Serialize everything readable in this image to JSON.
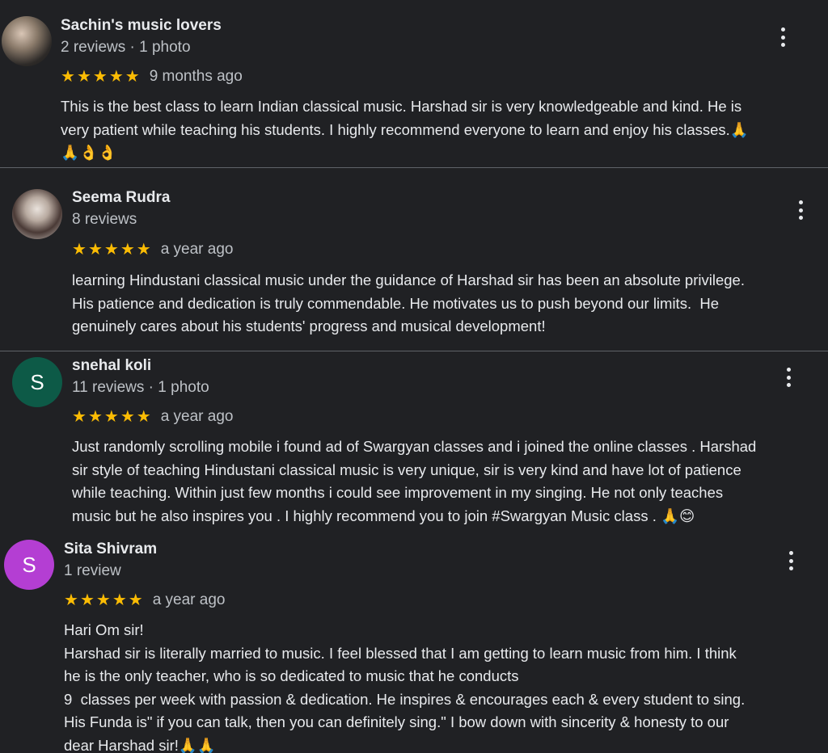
{
  "reviews": [
    {
      "name": "Sachin's music lovers",
      "meta": "2 reviews · 1 photo",
      "rating": 5,
      "time": "9 months ago",
      "text": "This is the best class to learn Indian classical music. Harshad sir is very knowledgeable and kind. He is\nvery patient while teaching his students. I highly recommend everyone to learn and enjoy his classes.🙏\n🙏👌👌",
      "avatar": "photo"
    },
    {
      "name": "Seema Rudra",
      "meta": "8 reviews",
      "rating": 5,
      "time": "a year ago",
      "text": "learning Hindustani classical music under the guidance of Harshad sir has been an absolute privilege.\nHis patience and dedication is truly commendable. He motivates us to push beyond our limits.  He\ngenuinely cares about his students' progress and musical development!",
      "avatar": "photo"
    },
    {
      "name": "snehal koli",
      "meta": "11 reviews · 1 photo",
      "rating": 5,
      "time": "a year ago",
      "text": "Just randomly scrolling mobile i found ad of Swargyan classes and i joined the online classes . Harshad\nsir style of teaching Hindustani classical music is very unique, sir is very kind and have lot of patience\nwhile teaching. Within just few months i could see improvement in my singing. He not only teaches\nmusic but he also inspires you . I highly recommend you to join #Swargyan Music class . 🙏😊",
      "avatar_letter": "S",
      "avatar_color": "#0d5a47"
    },
    {
      "name": "Sita Shivram",
      "meta": "1 review",
      "rating": 5,
      "time": "a year ago",
      "text": "Hari Om sir!\nHarshad sir is literally married to music. I feel blessed that I am getting to learn music from him. I think\nhe is the only teacher, who is so dedicated to music that he conducts\n9  classes per week with passion & dedication. He inspires & encourages each & every student to sing.\nHis Funda is\" if you can talk, then you can definitely sing.\" I bow down with sincerity & honesty to our\ndear Harshad sir!🙏🙏",
      "avatar_letter": "S",
      "avatar_color": "#b43ed3"
    }
  ],
  "icons": {
    "star": "★",
    "more": "more-vertical-icon"
  },
  "colors": {
    "background": "#202124",
    "star": "#fbbc04",
    "text": "#e8eaed",
    "secondary_text": "#bdc1c6"
  }
}
